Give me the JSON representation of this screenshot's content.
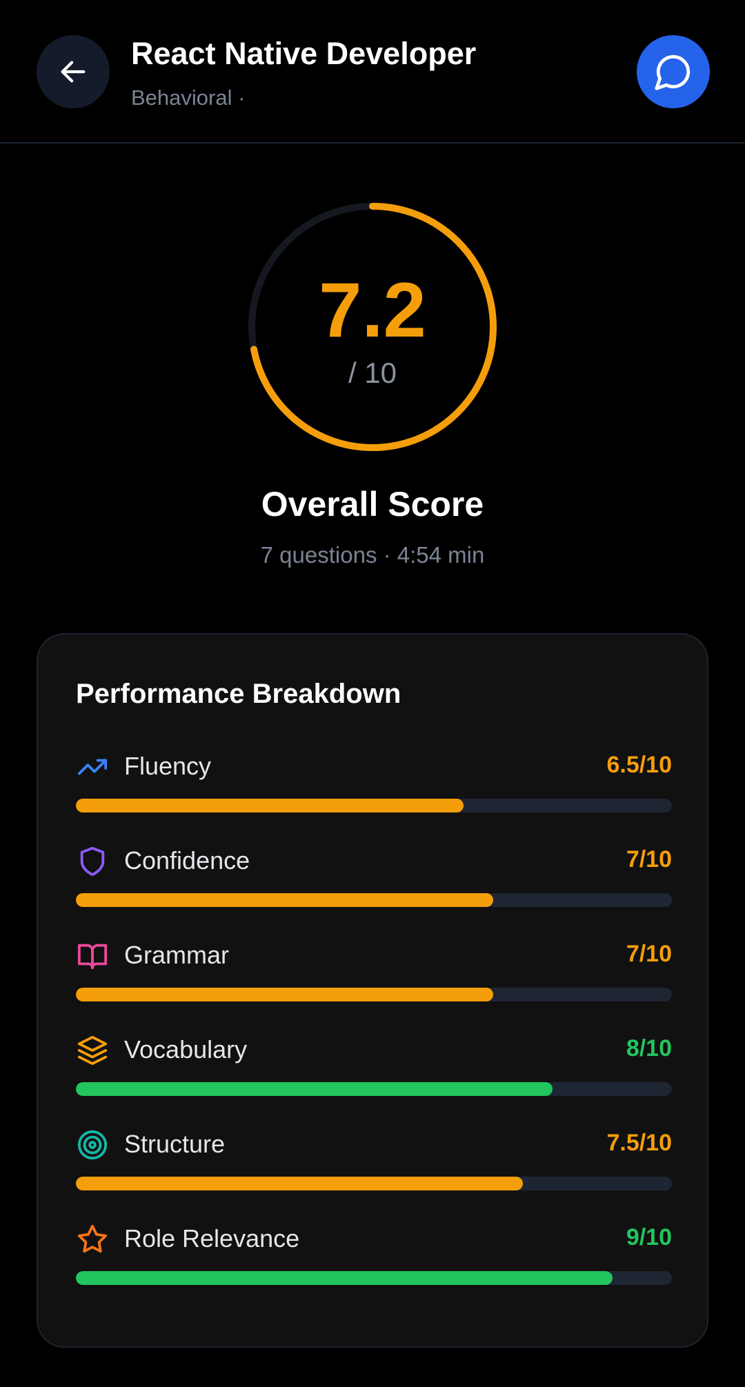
{
  "header": {
    "title": "React Native Developer",
    "subtitle": "Behavioral ·",
    "back_icon": "arrow-left-icon",
    "chat_icon": "chat-bubble-icon"
  },
  "score": {
    "value": "7.2",
    "max_label": "/ 10",
    "fraction": 0.72,
    "label": "Overall Score",
    "meta": "7 questions · 4:54 min"
  },
  "breakdown": {
    "title": "Performance Breakdown",
    "metrics": [
      {
        "label": "Fluency",
        "score": "6.5/10",
        "fraction": 0.65,
        "icon": "trending-up-icon",
        "icon_color": "#3b82f6",
        "color": "#f59e0b"
      },
      {
        "label": "Confidence",
        "score": "7/10",
        "fraction": 0.7,
        "icon": "shield-icon",
        "icon_color": "#8b5cf6",
        "color": "#f59e0b"
      },
      {
        "label": "Grammar",
        "score": "7/10",
        "fraction": 0.7,
        "icon": "book-open-icon",
        "icon_color": "#ec4899",
        "color": "#f59e0b"
      },
      {
        "label": "Vocabulary",
        "score": "8/10",
        "fraction": 0.8,
        "icon": "layers-icon",
        "icon_color": "#f59e0b",
        "color": "#22c55e"
      },
      {
        "label": "Structure",
        "score": "7.5/10",
        "fraction": 0.75,
        "icon": "target-icon",
        "icon_color": "#14b8a6",
        "color": "#f59e0b"
      },
      {
        "label": "Role Relevance",
        "score": "9/10",
        "fraction": 0.9,
        "icon": "star-icon",
        "icon_color": "#f97316",
        "color": "#22c55e"
      }
    ]
  },
  "colors": {
    "accent_orange": "#f59e0b",
    "accent_green": "#22c55e",
    "chat_button": "#2563eb",
    "track": "#1e2633"
  }
}
